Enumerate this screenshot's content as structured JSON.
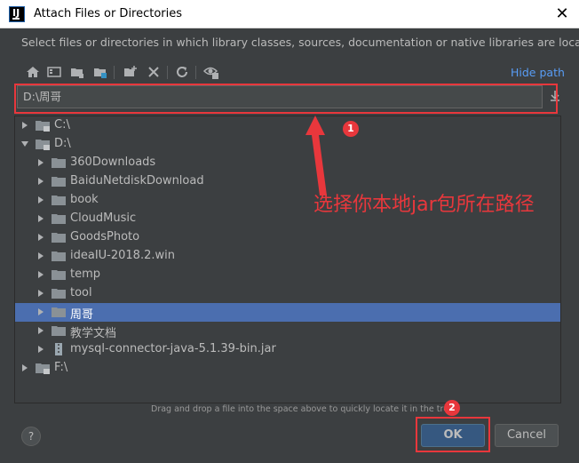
{
  "window": {
    "title": "Attach Files or Directories",
    "close_glyph": "✕"
  },
  "description": "Select files or directories in which library classes, sources, documentation or native libraries are located",
  "toolbar": {
    "icons": [
      "home-icon",
      "desktop-icon",
      "project-icon",
      "module-icon",
      "new-folder-icon",
      "delete-icon",
      "refresh-icon",
      "show-hidden-icon"
    ],
    "hide_path_label": "Hide path"
  },
  "path_field": {
    "value": "D:\\周哥"
  },
  "tree": {
    "items": [
      {
        "label": "C:\\",
        "kind": "drive",
        "expanded": false,
        "selected": false
      },
      {
        "label": "D:\\",
        "kind": "drive",
        "expanded": true,
        "selected": false
      },
      {
        "label": "360Downloads",
        "kind": "folder",
        "expanded": false,
        "selected": false
      },
      {
        "label": "BaiduNetdiskDownload",
        "kind": "folder",
        "expanded": false,
        "selected": false
      },
      {
        "label": "book",
        "kind": "folder",
        "expanded": false,
        "selected": false
      },
      {
        "label": "CloudMusic",
        "kind": "folder",
        "expanded": false,
        "selected": false
      },
      {
        "label": "GoodsPhoto",
        "kind": "folder",
        "expanded": false,
        "selected": false
      },
      {
        "label": "ideaIU-2018.2.win",
        "kind": "folder",
        "expanded": false,
        "selected": false
      },
      {
        "label": "temp",
        "kind": "folder",
        "expanded": false,
        "selected": false
      },
      {
        "label": "tool",
        "kind": "folder",
        "expanded": false,
        "selected": false
      },
      {
        "label": "周哥",
        "kind": "folder",
        "expanded": false,
        "selected": true
      },
      {
        "label": "教学文档",
        "kind": "folder",
        "expanded": false,
        "selected": false
      },
      {
        "label": "mysql-connector-java-5.1.39-bin.jar",
        "kind": "jar",
        "expanded": false,
        "selected": false
      },
      {
        "label": "F:\\",
        "kind": "drive",
        "expanded": false,
        "selected": false
      }
    ]
  },
  "annotations": {
    "text": "选择你本地jar包所在路径",
    "badge_1": "1",
    "badge_2": "2",
    "color": "#e8373c"
  },
  "hint": "Drag and drop a file into the space above to quickly locate it in the tree",
  "buttons": {
    "help": "?",
    "ok": "OK",
    "cancel": "Cancel"
  },
  "colors": {
    "background": "#3c3f41",
    "selection": "#4b6eaf",
    "link": "#589df6",
    "ok_button": "#365880"
  }
}
